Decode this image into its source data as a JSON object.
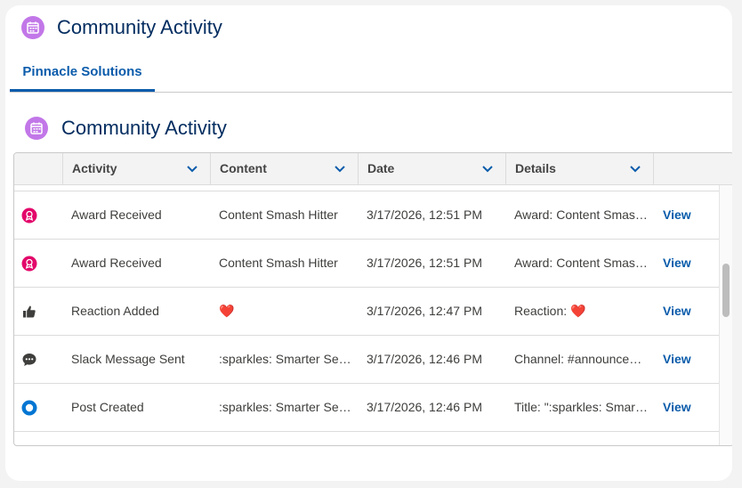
{
  "header": {
    "title": "Community Activity",
    "icon": "calendar-icon"
  },
  "tabs": [
    {
      "label": "Pinnacle Solutions"
    }
  ],
  "section": {
    "title": "Community Activity",
    "icon": "calendar-icon"
  },
  "table": {
    "columns": [
      {
        "label": ""
      },
      {
        "label": "Activity"
      },
      {
        "label": "Content"
      },
      {
        "label": "Date"
      },
      {
        "label": "Details"
      },
      {
        "label": ""
      }
    ],
    "rows": [
      {
        "icon": "award-icon",
        "activity": "Award Received",
        "content": "Content Smash Hitter",
        "date": "3/17/2026, 12:51 PM",
        "details": "Award: Content Smash Hitter",
        "action": "View"
      },
      {
        "icon": "award-icon",
        "activity": "Award Received",
        "content": "Content Smash Hitter",
        "date": "3/17/2026, 12:51 PM",
        "details": "Award: Content Smash Hitter",
        "action": "View"
      },
      {
        "icon": "thumbs-up-icon",
        "activity": "Reaction Added",
        "content": "❤️",
        "date": "3/17/2026, 12:47 PM",
        "details": "Reaction: ❤️",
        "action": "View"
      },
      {
        "icon": "chat-bubble-icon",
        "activity": "Slack Message Sent",
        "content": ":sparkles: Smarter Search",
        "date": "3/17/2026, 12:46 PM",
        "details": "Channel: #announcements",
        "action": "View"
      },
      {
        "icon": "post-circle-icon",
        "activity": "Post Created",
        "content": ":sparkles: Smarter Search",
        "date": "3/17/2026, 12:46 PM",
        "details": "Title: \":sparkles: Smarter Search",
        "action": "View"
      }
    ]
  },
  "colors": {
    "brand": "#0b5cab",
    "title": "#032d60",
    "award": "#e3066a",
    "post": "#0176d3",
    "app_icon": "#c277e8"
  }
}
